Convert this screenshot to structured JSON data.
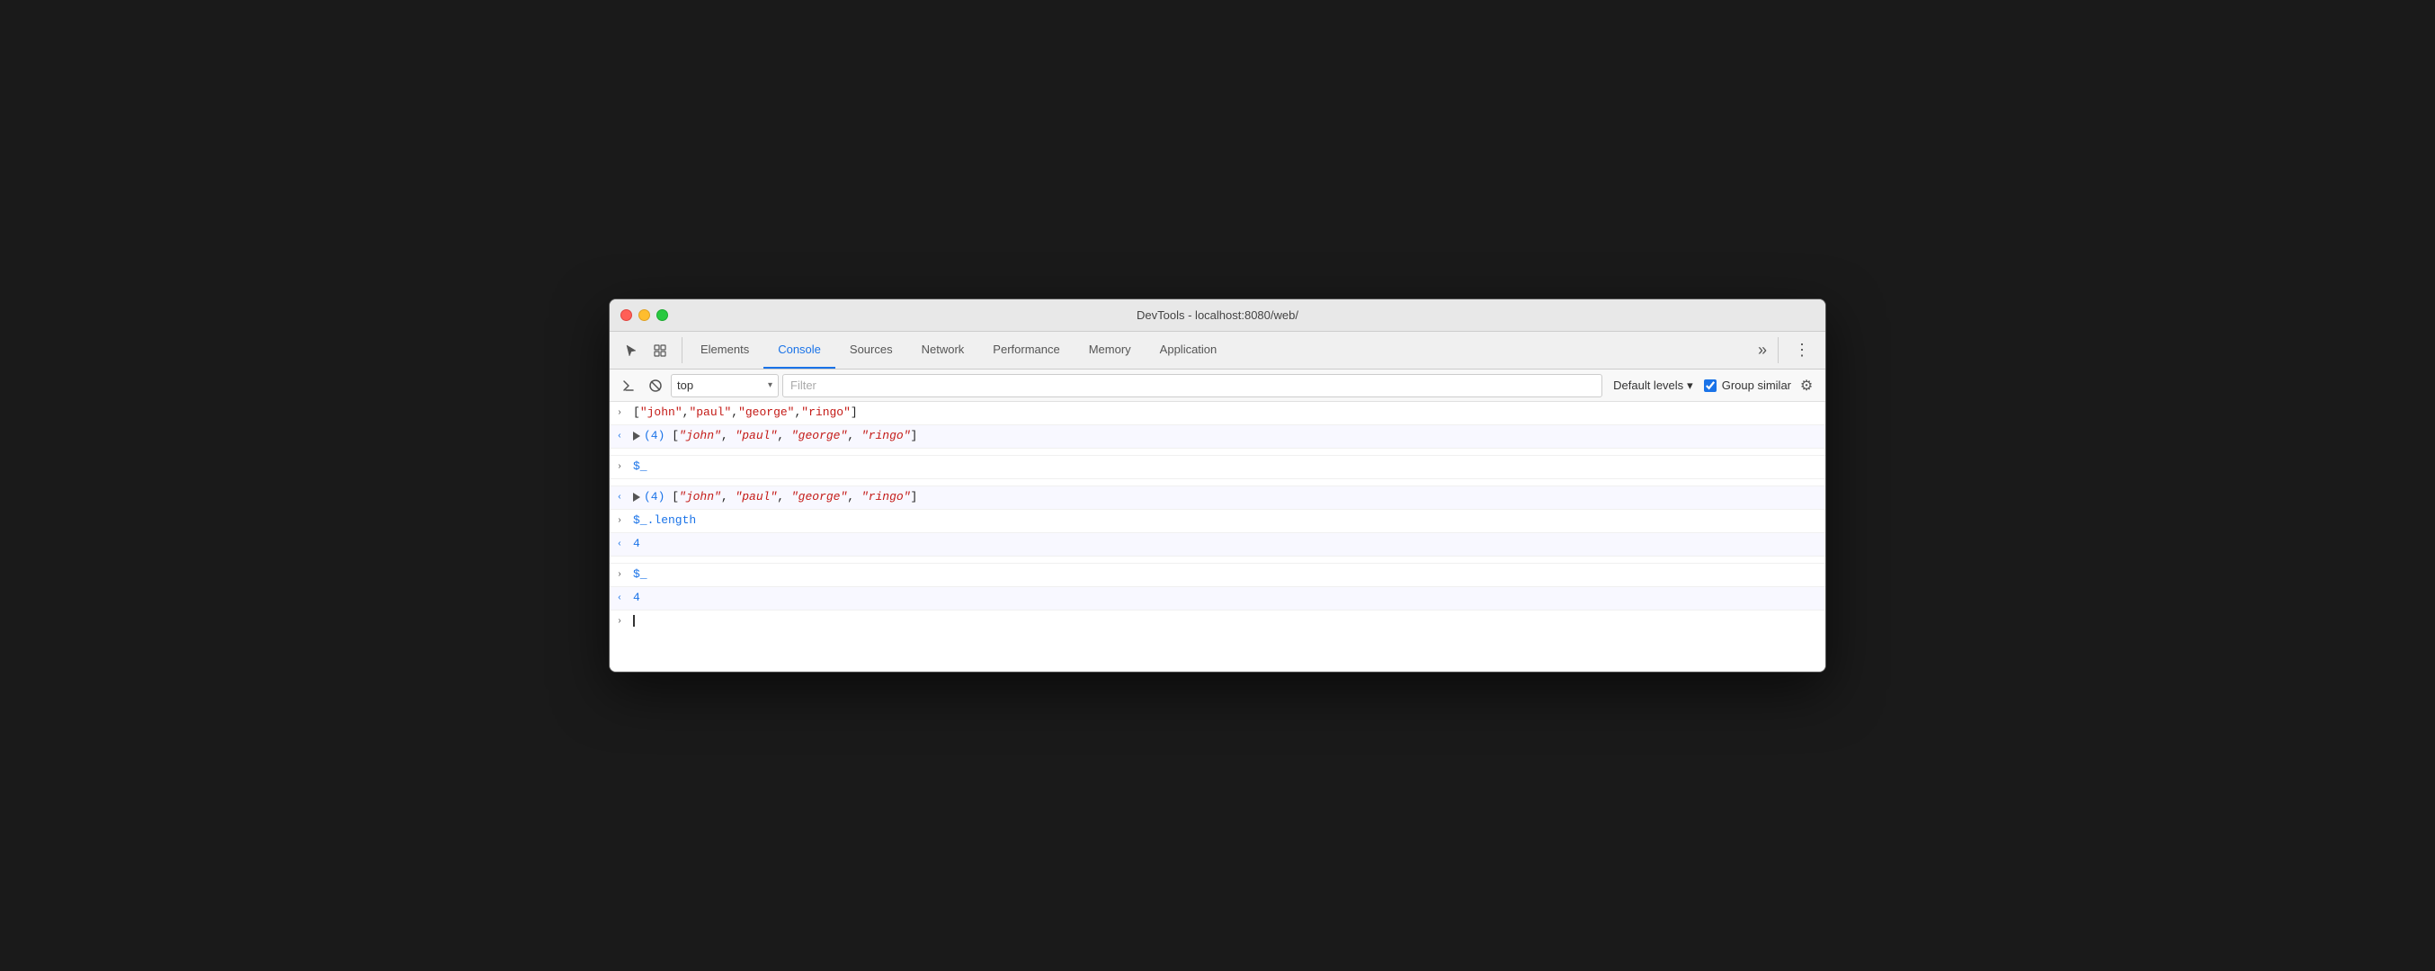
{
  "titleBar": {
    "title": "DevTools - localhost:8080/web/"
  },
  "tabs": [
    {
      "id": "elements",
      "label": "Elements",
      "active": false
    },
    {
      "id": "console",
      "label": "Console",
      "active": true
    },
    {
      "id": "sources",
      "label": "Sources",
      "active": false
    },
    {
      "id": "network",
      "label": "Network",
      "active": false
    },
    {
      "id": "performance",
      "label": "Performance",
      "active": false
    },
    {
      "id": "memory",
      "label": "Memory",
      "active": false
    },
    {
      "id": "application",
      "label": "Application",
      "active": false
    }
  ],
  "toolbar": {
    "topSelect": "top",
    "filterPlaceholder": "Filter",
    "levelsLabel": "Default levels",
    "groupSimilarLabel": "Group similar"
  },
  "consoleRows": [
    {
      "type": "input",
      "arrowDir": "right",
      "content": "[\"john\",\"paul\",\"george\",\"ringo\"]"
    },
    {
      "type": "output",
      "arrowDir": "left",
      "expandable": true,
      "content": "(4) [\"john\", \"paul\", \"george\", \"ringo\"]"
    },
    {
      "type": "empty"
    },
    {
      "type": "input",
      "arrowDir": "right",
      "content": "$_"
    },
    {
      "type": "empty"
    },
    {
      "type": "output",
      "arrowDir": "left",
      "expandable": true,
      "content": "(4) [\"john\", \"paul\", \"george\", \"ringo\"]"
    },
    {
      "type": "input",
      "arrowDir": "right",
      "content": "$_.length"
    },
    {
      "type": "output",
      "arrowDir": "left",
      "expandable": false,
      "content": "4",
      "isNumber": true
    },
    {
      "type": "empty"
    },
    {
      "type": "input",
      "arrowDir": "right",
      "content": "$_"
    },
    {
      "type": "output",
      "arrowDir": "left",
      "expandable": false,
      "content": "4",
      "isNumber": true
    },
    {
      "type": "cursor",
      "arrowDir": "right"
    }
  ],
  "icons": {
    "cursor": "↖",
    "layers": "⧉",
    "more": "»",
    "kebab": "⋮",
    "play": "▶",
    "block": "⊘",
    "gear": "⚙",
    "dropdown": "▾",
    "chevronRight": "›",
    "chevronLeft": "‹"
  }
}
